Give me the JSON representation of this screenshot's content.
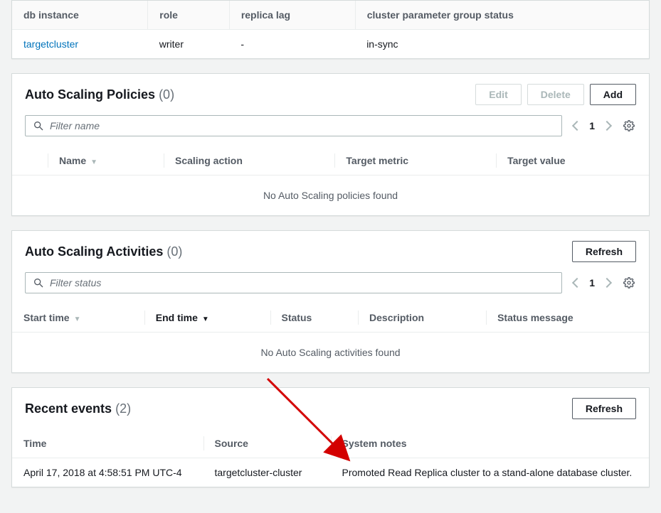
{
  "db_instances_table": {
    "headers": [
      "db instance",
      "role",
      "replica lag",
      "cluster parameter group status"
    ],
    "row": {
      "instance": "targetcluster",
      "role": "writer",
      "lag": "-",
      "status": "in-sync"
    }
  },
  "auto_scaling_policies": {
    "title": "Auto Scaling Policies",
    "count": "(0)",
    "buttons": {
      "edit": "Edit",
      "delete": "Delete",
      "add": "Add"
    },
    "filter_placeholder": "Filter name",
    "page": "1",
    "columns": [
      "Name",
      "Scaling action",
      "Target metric",
      "Target value"
    ],
    "empty": "No Auto Scaling policies found"
  },
  "auto_scaling_activities": {
    "title": "Auto Scaling Activities",
    "count": "(0)",
    "refresh": "Refresh",
    "filter_placeholder": "Filter status",
    "page": "1",
    "columns": [
      "Start time",
      "End time",
      "Status",
      "Description",
      "Status message"
    ],
    "empty": "No Auto Scaling activities found"
  },
  "recent_events": {
    "title": "Recent events",
    "count": "(2)",
    "refresh": "Refresh",
    "columns": [
      "Time",
      "Source",
      "System notes"
    ],
    "row": {
      "time": "April 17, 2018 at 4:58:51 PM UTC-4",
      "source": "targetcluster-cluster",
      "notes": "Promoted Read Replica cluster to a stand-alone database cluster."
    }
  }
}
